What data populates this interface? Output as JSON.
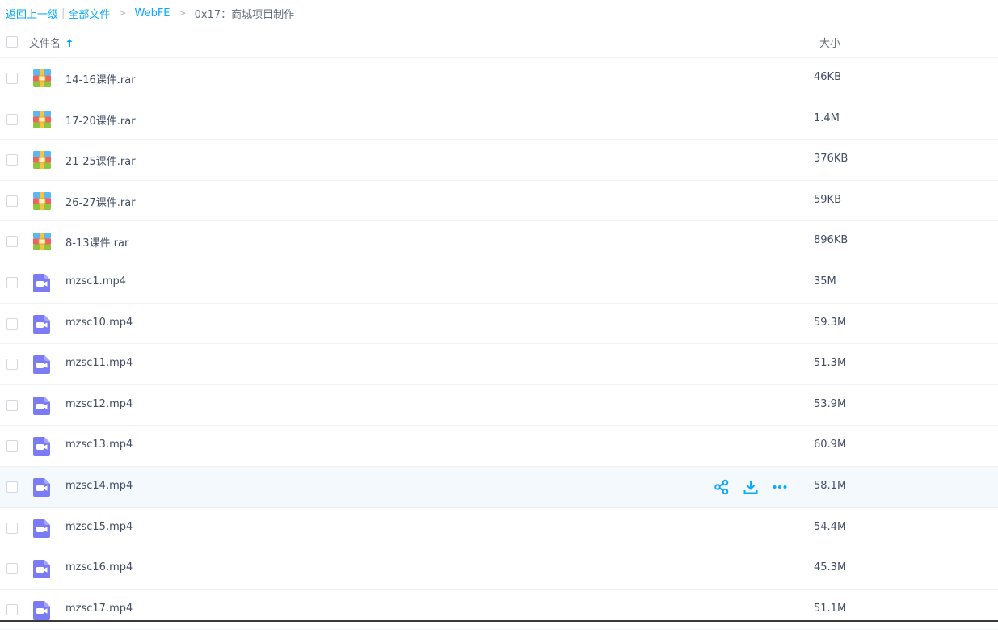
{
  "breadcrumb": {
    "back": "返回上一级",
    "all_files": "全部文件",
    "folder": "WebFE",
    "current": "0x17：商城项目制作",
    "sep_bar": "|",
    "sep_arrow": ">"
  },
  "header": {
    "name_label": "文件名",
    "size_label": "大小",
    "sort_icon": "arrow-up-icon"
  },
  "colors": {
    "accent": "#09aaff",
    "video_icon": "#7b7cf5",
    "hover_row": "#f4f9fd"
  },
  "files": [
    {
      "name": "14-16课件.rar",
      "size": "46KB",
      "type": "archive"
    },
    {
      "name": "17-20课件.rar",
      "size": "1.4M",
      "type": "archive"
    },
    {
      "name": "21-25课件.rar",
      "size": "376KB",
      "type": "archive"
    },
    {
      "name": "26-27课件.rar",
      "size": "59KB",
      "type": "archive"
    },
    {
      "name": "8-13课件.rar",
      "size": "896KB",
      "type": "archive"
    },
    {
      "name": "mzsc1.mp4",
      "size": "35M",
      "type": "video"
    },
    {
      "name": "mzsc10.mp4",
      "size": "59.3M",
      "type": "video"
    },
    {
      "name": "mzsc11.mp4",
      "size": "51.3M",
      "type": "video"
    },
    {
      "name": "mzsc12.mp4",
      "size": "53.9M",
      "type": "video"
    },
    {
      "name": "mzsc13.mp4",
      "size": "60.9M",
      "type": "video"
    },
    {
      "name": "mzsc14.mp4",
      "size": "58.1M",
      "type": "video",
      "hovered": true
    },
    {
      "name": "mzsc15.mp4",
      "size": "54.4M",
      "type": "video"
    },
    {
      "name": "mzsc16.mp4",
      "size": "45.3M",
      "type": "video"
    },
    {
      "name": "mzsc17.mp4",
      "size": "51.1M",
      "type": "video"
    }
  ],
  "row_actions": [
    "share-icon",
    "download-icon",
    "more-icon"
  ]
}
